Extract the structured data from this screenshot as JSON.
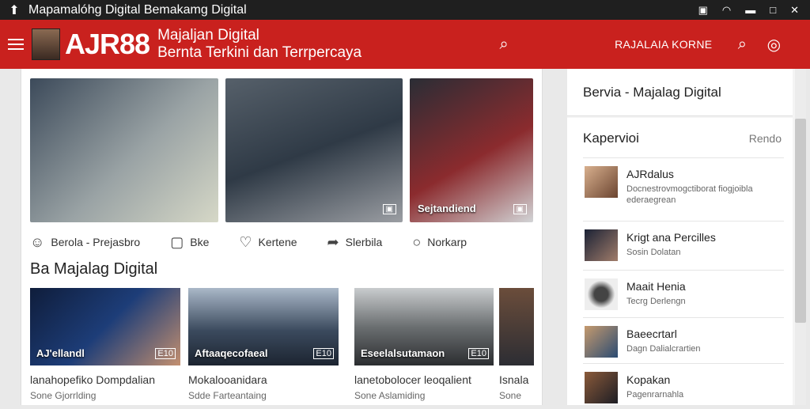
{
  "window": {
    "title": "Mapamalóhg Digital Bemakamg Digital"
  },
  "header": {
    "logo": "AJR88",
    "tagline_1": "Majaljan Digital",
    "tagline_2": "Bernta Terkini dan Terrpercaya",
    "link": "RAJALAIA KORNE",
    "accent": "#c9211e"
  },
  "hero": [
    {
      "caption": "",
      "badge": ""
    },
    {
      "caption": "",
      "badge": ""
    },
    {
      "caption": "Sejtandiend",
      "badge": ""
    }
  ],
  "actions": [
    {
      "icon": "user-icon",
      "label": "Berola - Prejasbro"
    },
    {
      "icon": "chat-icon",
      "label": "Bke"
    },
    {
      "icon": "heart-icon",
      "label": "Kertene"
    },
    {
      "icon": "share-icon",
      "label": "Slerbila"
    },
    {
      "icon": "like-icon",
      "label": "Norkarp"
    }
  ],
  "section": {
    "title": "Ba Majalag Digital"
  },
  "cards": [
    {
      "caption": "AJ'ellandl",
      "badge": "E10",
      "title": "lanahopefiko Dompdalian",
      "meta": "Sone   Gjorrlding"
    },
    {
      "caption": "Aftaaqecofaeal",
      "badge": "E10",
      "title": "Mokalooanidara",
      "meta": "Sdde   Farteantaing"
    },
    {
      "caption": "Eseelalsutamaon",
      "badge": "E10",
      "title": "lanetobolocer leoqalient",
      "meta": "Sone   Aslamiding"
    },
    {
      "caption": "",
      "badge": "",
      "title": "Isnala",
      "meta": "Sone"
    }
  ],
  "sidebar": {
    "title": "Bervia - Majalag Digital",
    "panel_title": "Kapervioi",
    "panel_more": "Rendo",
    "items": [
      {
        "title": "AJRdalus",
        "sub": "Docnestrovmogctiborat fiogjoibla ederaegrean"
      },
      {
        "title": "Krigt ana Percilles",
        "sub": "Sosin Dolatan"
      },
      {
        "title": "Maait Henia",
        "sub": "Tecrg Derlengn"
      },
      {
        "title": "Baeecrtarl",
        "sub": "Dagn Dalialcrartien"
      },
      {
        "title": "Kopakan",
        "sub": "Pagenrarnahla"
      }
    ]
  }
}
